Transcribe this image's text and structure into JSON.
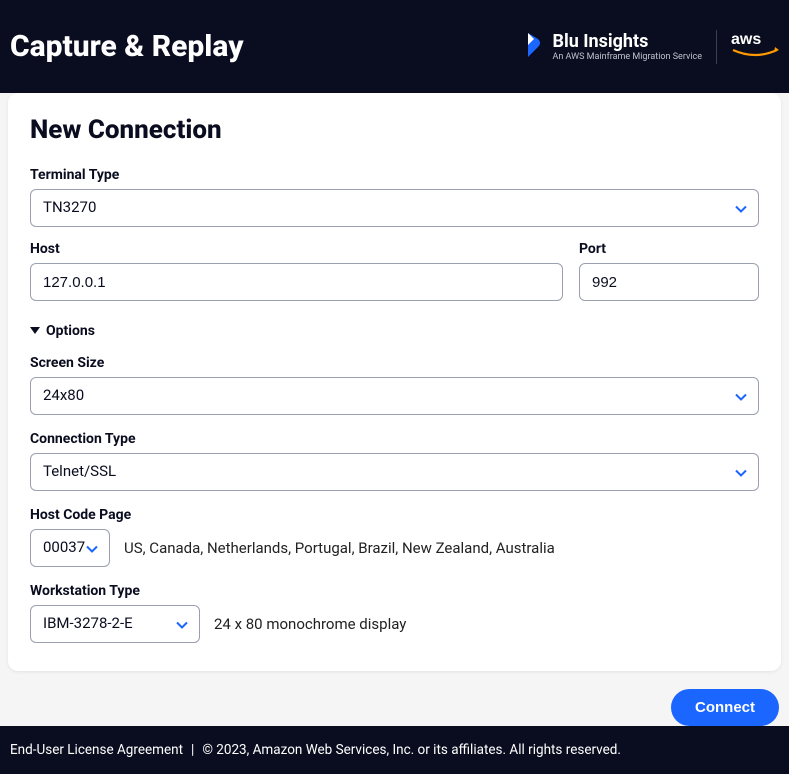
{
  "header": {
    "title": "Capture & Replay",
    "brand_name": "Blu Insights",
    "brand_sub": "An AWS Mainframe Migration Service",
    "aws": "aws"
  },
  "panel": {
    "title": "New Connection",
    "labels": {
      "terminal_type": "Terminal Type",
      "host": "Host",
      "port": "Port",
      "options": "Options",
      "screen_size": "Screen Size",
      "connection_type": "Connection Type",
      "host_code_page": "Host Code Page",
      "workstation_type": "Workstation Type"
    },
    "values": {
      "terminal_type": "TN3270",
      "host": "127.0.0.1",
      "port": "992",
      "screen_size": "24x80",
      "connection_type": "Telnet/SSL",
      "host_code_page": "00037",
      "host_code_page_desc": "US, Canada, Netherlands, Portugal, Brazil, New Zealand, Australia",
      "workstation_type": "IBM-3278-2-E",
      "workstation_type_desc": "24 x 80 monochrome display"
    }
  },
  "actions": {
    "connect": "Connect"
  },
  "footer": {
    "eula": "End-User License Agreement",
    "sep": "|",
    "copyright": "© 2023, Amazon Web Services, Inc. or its affiliates. All rights reserved."
  },
  "colors": {
    "primary": "#1b66ff",
    "dark": "#0a0d1f",
    "aws_orange": "#ff9900"
  }
}
